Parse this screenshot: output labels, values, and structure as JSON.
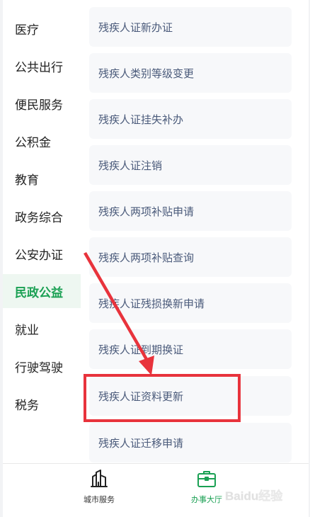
{
  "sidebar": {
    "items": [
      {
        "label": "医疗",
        "active": false
      },
      {
        "label": "公共出行",
        "active": false
      },
      {
        "label": "便民服务",
        "active": false
      },
      {
        "label": "公积金",
        "active": false
      },
      {
        "label": "教育",
        "active": false
      },
      {
        "label": "政务综合",
        "active": false
      },
      {
        "label": "公安办证",
        "active": false
      },
      {
        "label": "民政公益",
        "active": true
      },
      {
        "label": "就业",
        "active": false
      },
      {
        "label": "行驶驾驶",
        "active": false
      },
      {
        "label": "税务",
        "active": false
      }
    ]
  },
  "services": [
    {
      "label": "残疾人证新办证"
    },
    {
      "label": "残疾人类别等级变更"
    },
    {
      "label": "残疾人证挂失补办"
    },
    {
      "label": "残疾人证注销"
    },
    {
      "label": "残疾人两项补贴申请"
    },
    {
      "label": "残疾人两项补贴查询"
    },
    {
      "label": "残疾人证残损换新申请"
    },
    {
      "label": "残疾人证到期换证"
    },
    {
      "label": "残疾人证资料更新"
    },
    {
      "label": "残疾人证迁移申请"
    }
  ],
  "tabbar": {
    "tabs": [
      {
        "label": "城市服务",
        "icon": "city-building-icon",
        "active": false
      },
      {
        "label": "办事大厅",
        "icon": "briefcase-icon",
        "active": true
      }
    ]
  },
  "colors": {
    "accent": "#1aa053",
    "annotation": "#e8333c",
    "card_text": "#4a5a7a"
  },
  "watermark": {
    "text": "Baidu经验"
  }
}
